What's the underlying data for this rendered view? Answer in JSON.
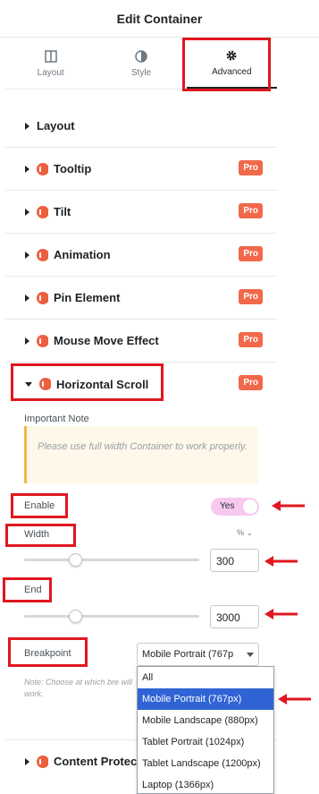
{
  "header": {
    "title": "Edit Container"
  },
  "tabs": [
    {
      "label": "Layout",
      "icon": "layout-icon"
    },
    {
      "label": "Style",
      "icon": "style-icon"
    },
    {
      "label": "Advanced",
      "icon": "gear-icon"
    }
  ],
  "sections": [
    {
      "label": "Layout",
      "pro": ""
    },
    {
      "label": "Tooltip",
      "pro": "Pro"
    },
    {
      "label": "Tilt",
      "pro": "Pro"
    },
    {
      "label": "Animation",
      "pro": "Pro"
    },
    {
      "label": "Pin Element",
      "pro": "Pro"
    },
    {
      "label": "Mouse Move Effect",
      "pro": "Pro"
    },
    {
      "label": "Horizontal Scroll",
      "pro": "Pro"
    },
    {
      "label": "Content Protec"
    }
  ],
  "horizontal_scroll": {
    "note_title": "Important Note",
    "note_text": "Please use full width Container to work properly.",
    "enable_label": "Enable",
    "enable_value": "Yes",
    "width_label": "Width",
    "width_unit": "% ⌄",
    "width_value": "300",
    "end_label": "End",
    "end_value": "3000",
    "breakpoint_label": "Breakpoint",
    "breakpoint_selected": "Mobile Portrait (767p",
    "breakpoint_hint": "Note: Choose at which bre will work.",
    "breakpoint_options": [
      "All",
      "Mobile Portrait (767px)",
      "Mobile Landscape (880px)",
      "Tablet Portrait (1024px)",
      "Tablet Landscape (1200px)",
      "Laptop (1366px)"
    ]
  },
  "colors": {
    "pro_badge": "#f1684a",
    "highlight": "#e0171f",
    "selected_option": "#3064d4",
    "toggle_on": "#f7c8f0"
  }
}
